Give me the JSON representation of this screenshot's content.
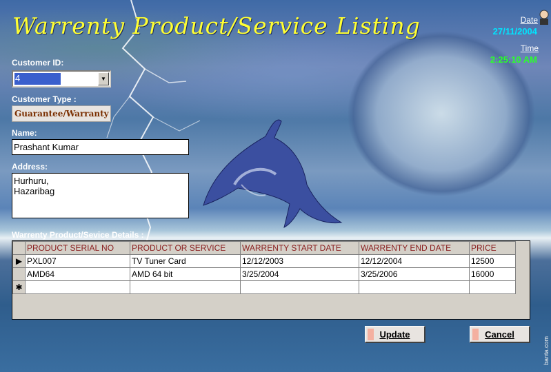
{
  "window": {
    "title": "Warrenty Product/Service Listing"
  },
  "date": {
    "label": "Date",
    "value": "27/11/2004"
  },
  "time": {
    "label": "Time",
    "value": "2:25:10 AM"
  },
  "customer_id": {
    "label": "Customer ID:",
    "value": "4"
  },
  "customer_type": {
    "label": "Customer Type :",
    "value": "Guarantee/Warranty"
  },
  "name": {
    "label": "Name:",
    "value": "Prashant Kumar"
  },
  "address": {
    "label": "Address:",
    "line1": "Hurhuru,",
    "line2": "Hazaribag"
  },
  "details": {
    "label": "Warrenty Product/Sevice Details :",
    "columns": [
      "PRODUCT SERIAL NO",
      "PRODUCT OR SERVICE",
      "WARRENTY START DATE",
      "WARRENTY END DATE",
      "PRICE"
    ],
    "rows": [
      {
        "indicator": "▶",
        "cells": [
          "PXL007",
          "TV Tuner Card",
          "12/12/2003",
          "12/12/2004",
          "12500"
        ]
      },
      {
        "indicator": "",
        "cells": [
          "AMD64",
          "AMD 64 bit",
          "3/25/2004",
          "3/25/2006",
          "16000"
        ]
      },
      {
        "indicator": "✱",
        "cells": [
          "",
          "",
          "",
          "",
          ""
        ]
      }
    ]
  },
  "buttons": {
    "update": "Update",
    "cancel": "Cancel"
  },
  "watermark": "banta.com",
  "colors": {
    "title": "#ffff33",
    "date": "#00e5ff",
    "time": "#2bff2b",
    "header_text": "#8a2020"
  }
}
